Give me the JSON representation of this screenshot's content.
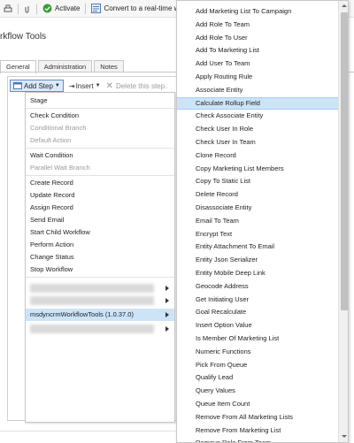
{
  "toolbar": {
    "activate_label": "Activate",
    "convert_label": "Convert to a real-time w"
  },
  "page": {
    "title": "rkflow Tools"
  },
  "tabs": [
    {
      "label": "General",
      "active": true
    },
    {
      "label": "Administration",
      "active": false
    },
    {
      "label": "Notes",
      "active": false
    }
  ],
  "step_toolbar": {
    "add_step_label": "Add Step",
    "insert_label": "Insert",
    "delete_label": "Delete this step."
  },
  "step_menu": {
    "items": [
      {
        "label": "Stage",
        "disabled": false
      },
      {
        "label": "Check Condition",
        "disabled": false
      },
      {
        "label": "Conditional Branch",
        "disabled": true
      },
      {
        "label": "Default Action",
        "disabled": true
      },
      {
        "label": "Wait Condition",
        "disabled": false
      },
      {
        "label": "Parallel Wait Branch",
        "disabled": true
      },
      {
        "label": "Create Record",
        "disabled": false
      },
      {
        "label": "Update Record",
        "disabled": false
      },
      {
        "label": "Assign Record",
        "disabled": false
      },
      {
        "label": "Send Email",
        "disabled": false
      },
      {
        "label": "Start Child Workflow",
        "disabled": false
      },
      {
        "label": "Perform Action",
        "disabled": false
      },
      {
        "label": "Change Status",
        "disabled": false
      },
      {
        "label": "Stop Workflow",
        "disabled": false
      }
    ],
    "highlighted_submenu_label": "msdyncrmWorkflowTools (1.0.37.0)"
  },
  "submenu": {
    "highlighted": "Calculate Rollup Field",
    "items": [
      "Add Marketing List To Campaign",
      "Add Role To Team",
      "Add Role To User",
      "Add To Marketing List",
      "Add User To Team",
      "Apply Routing Rule",
      "Associate Entity",
      "Calculate Rollup Field",
      "Check Associate Entity",
      "Check User In Role",
      "Check User In Team",
      "Clone Record",
      "Copy Marketing List Members",
      "Copy To Static List",
      "Delete Record",
      "Disassociate Entity",
      "Email To Team",
      "Encrypt Text",
      "Entity Attachment To Email",
      "Entity Json Serializer",
      "Entity Mobile Deep Link",
      "Geocode Address",
      "Get Initiating User",
      "Goal Recalculate",
      "Insert Option Value",
      "Is Member Of Marketing List",
      "Numeric Functions",
      "Pick From Queue",
      "Qualify Lead",
      "Query Values",
      "Queue Item Count",
      "Remove From All Marketing Lists",
      "Remove From Marketing List",
      "Remove Role From Team"
    ]
  }
}
